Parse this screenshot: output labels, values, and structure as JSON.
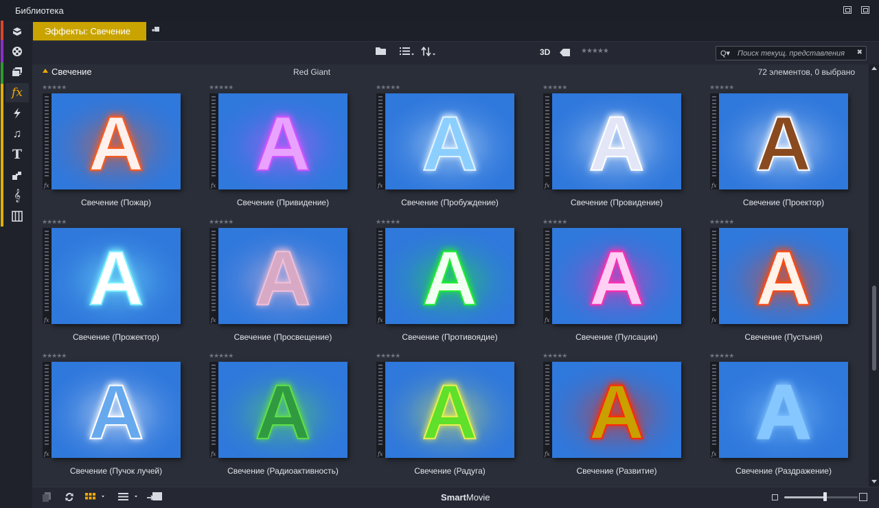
{
  "window": {
    "title": "Библиотека"
  },
  "tab": {
    "label": "Эффекты: Свечение"
  },
  "toolbar": {
    "label_3d": "3D",
    "rating_stars": "★★★★★",
    "search_icon": "Q▾",
    "search_placeholder": "Поиск текущ. представления",
    "search_clear": "✖"
  },
  "section": {
    "name": "Свечение",
    "vendor": "Red Giant",
    "count_text": "72 элементов, 0 выбрано"
  },
  "items": [
    {
      "stars": "★★★★★",
      "label": "Свечение (Пожар)",
      "letter": "A",
      "fill": "#fff2ee",
      "glow": "#ff5a1a"
    },
    {
      "stars": "★★★★★",
      "label": "Свечение (Привидение)",
      "letter": "A",
      "fill": "#e9a3ff",
      "glow": "#d255ff"
    },
    {
      "stars": "★★★★★",
      "label": "Свечение (Пробуждение)",
      "letter": "A",
      "fill": "#8ccfff",
      "glow": "#e2f4ff"
    },
    {
      "stars": "★★★★★",
      "label": "Свечение (Провидение)",
      "letter": "A",
      "fill": "#e3e6f6",
      "glow": "#ffffff"
    },
    {
      "stars": "★★★★★",
      "label": "Свечение (Проектор)",
      "letter": "A",
      "fill": "#8a4a1f",
      "glow": "#ffffff"
    },
    {
      "stars": "★★★★★",
      "label": "Свечение (Прожектор)",
      "letter": "A",
      "fill": "#ffffff",
      "glow": "#7ff0ff"
    },
    {
      "stars": "★★★★★",
      "label": "Свечение (Просвещение)",
      "letter": "A",
      "fill": "#d8a9c4",
      "glow": "#f0c0d8"
    },
    {
      "stars": "★★★★★",
      "label": "Свечение (Противоядие)",
      "letter": "A",
      "fill": "#f2fff2",
      "glow": "#22ee33"
    },
    {
      "stars": "★★★★★",
      "label": "Свечение (Пулсации)",
      "letter": "A",
      "fill": "#ffd0f5",
      "glow": "#ff2fb0"
    },
    {
      "stars": "★★★★★",
      "label": "Свечение (Пустыня)",
      "letter": "A",
      "fill": "#fff3ea",
      "glow": "#ff4a10"
    },
    {
      "stars": "★★★★★",
      "label": "Свечение (Пучок лучей)",
      "letter": "A",
      "fill": "#67a9ee",
      "glow": "#ffffff"
    },
    {
      "stars": "★★★★★",
      "label": "Свечение (Радиоактивность)",
      "letter": "A",
      "fill": "#2f9a40",
      "glow": "#5fe04a"
    },
    {
      "stars": "★★★★★",
      "label": "Свечение (Радуга)",
      "letter": "A",
      "fill": "#5fe02a",
      "glow": "#e9f050"
    },
    {
      "stars": "★★★★★",
      "label": "Свечение (Развитие)",
      "letter": "A",
      "fill": "#c8a000",
      "glow": "#ff2a00"
    },
    {
      "stars": "★★★★★",
      "label": "Свечение (Раздражение)",
      "letter": "A",
      "fill": "#86c7ff",
      "glow": "#86c7ff"
    }
  ],
  "bottombar": {
    "brand_bold": "Smart",
    "brand_rest": "Movie",
    "zoom_level": 0.55
  },
  "colors": {
    "accent": "#f2a900",
    "tab_bg": "#c9a400",
    "thumb_bg": "#2f78dc",
    "category_strips": [
      "#e0442a",
      "#8b2fc9",
      "#2e9a2e",
      "#e0b000"
    ]
  }
}
